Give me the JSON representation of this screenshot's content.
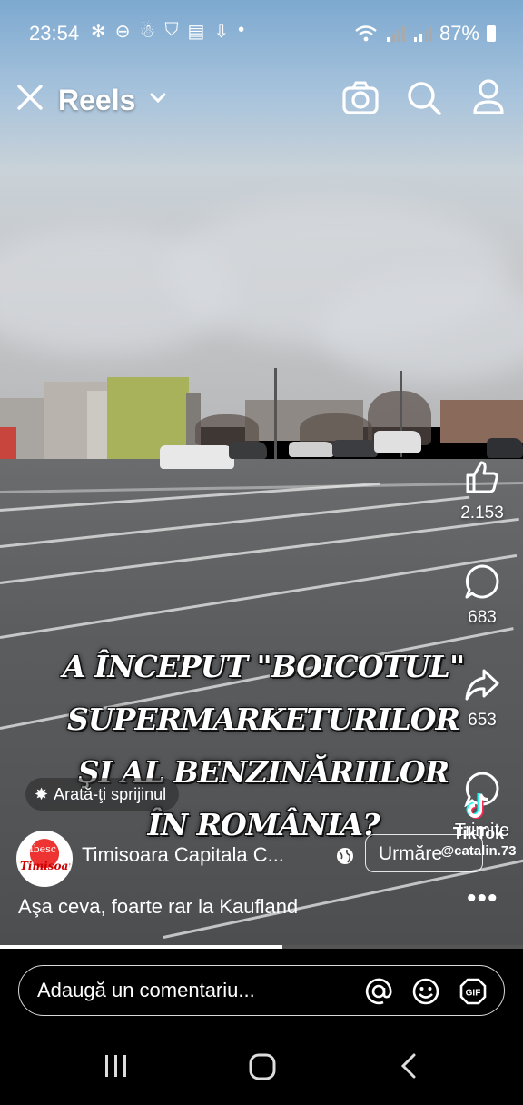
{
  "status_bar": {
    "time": "23:54",
    "notification_icons": [
      "fan-icon",
      "do-not-disturb-icon",
      "app-icon",
      "shield-icon",
      "clapperboard-icon",
      "download-icon",
      "dot-icon"
    ],
    "battery": "87%",
    "wifi_icon": "wifi-icon",
    "signal_icons": [
      "signal-1-icon",
      "signal-2-icon"
    ]
  },
  "header": {
    "title": "Reels",
    "icons": [
      "close-icon",
      "chevron-down-icon",
      "camera-icon",
      "search-icon",
      "profile-icon"
    ]
  },
  "actions": {
    "like_count": "2.153",
    "comment_count": "683",
    "share_count": "653",
    "send_label": "Trimite"
  },
  "overlay_text": {
    "lines": [
      "A ÎNCEPUT \"BOICOTUL\"",
      "SUPERMARKETURILOR",
      "ŞI AL BENZINĂRIILOR",
      "ÎN ROMÂNIA?"
    ]
  },
  "support_chip": {
    "label": "Arată-ţi sprijinul"
  },
  "author": {
    "name": "Timisoara Capitala C...",
    "follow_label": "Urmăre",
    "avatar_line1": "iubesc",
    "avatar_line2": "Timisoara"
  },
  "tiktok_watermark": {
    "brand": "TikTok",
    "user": "@catalin.73"
  },
  "caption": "Aşa ceva, foarte rar la Kaufland",
  "progress": {
    "fraction": 0.54
  },
  "comment_bar": {
    "placeholder": "Adaugă un comentariu...",
    "icons": [
      "at-icon",
      "emoji-icon",
      "gif-icon"
    ],
    "gif_label": "GIF"
  },
  "nav_bar": {
    "icons": [
      "recent-apps-icon",
      "home-icon",
      "back-icon"
    ]
  },
  "colors": {
    "background": "#000000",
    "text": "#ffffff",
    "avatar_red": "#e33333"
  }
}
